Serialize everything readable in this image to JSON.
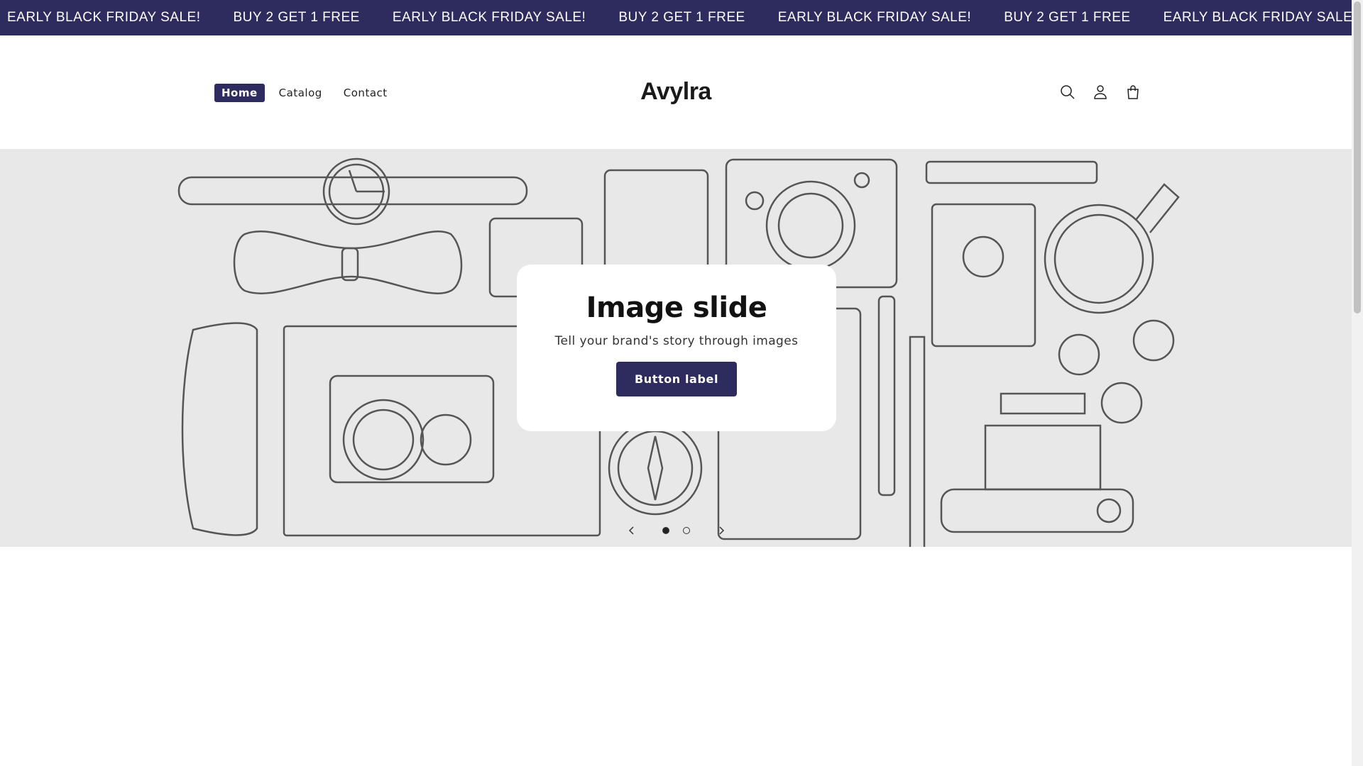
{
  "announcement": {
    "items": [
      "EARLY BLACK FRIDAY SALE!",
      "BUY 2 GET 1 FREE",
      "EARLY BLACK FRIDAY SALE!",
      "BUY 2 GET 1 FREE",
      "EARLY BLACK FRIDAY SALE!",
      "BUY 2 GET 1 FREE",
      "EARLY BLACK FRIDAY SALE!"
    ]
  },
  "header": {
    "logo": "Avylra",
    "nav": [
      {
        "label": "Home",
        "active": true
      },
      {
        "label": "Catalog"
      },
      {
        "label": "Contact"
      }
    ],
    "icons": [
      "search-icon",
      "account-icon",
      "cart-icon"
    ]
  },
  "hero": {
    "title": "Image slide",
    "subtitle": "Tell your brand's story through images",
    "button_label": "Button label",
    "slides_total": 2,
    "current_slide": 1
  },
  "colors": {
    "accent": "#2e2b5f",
    "hero_bg": "#e8e8e8"
  }
}
